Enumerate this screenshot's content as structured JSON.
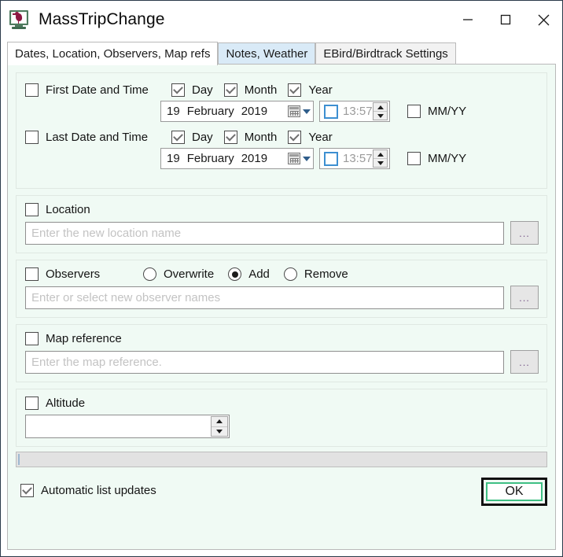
{
  "window": {
    "title": "MassTripChange",
    "icon": "app-bird-monitor-icon",
    "controls": {
      "minimize": "—",
      "maximize": "□",
      "close": "✕"
    }
  },
  "tabs": [
    {
      "label": "Dates, Location, Observers, Map refs",
      "state": "active"
    },
    {
      "label": "Notes, Weather",
      "state": "hot"
    },
    {
      "label": "EBird/Birdtrack Settings",
      "state": "normal"
    }
  ],
  "dates_group": {
    "first": {
      "label": "First Date and Time",
      "checked": false,
      "parts": [
        {
          "label": "Day",
          "checked": true
        },
        {
          "label": "Month",
          "checked": true
        },
        {
          "label": "Year",
          "checked": true
        }
      ],
      "date": {
        "day": "19",
        "month": "February",
        "year": "2019"
      },
      "time": {
        "value": "13:57",
        "checked": false
      },
      "mmyy": {
        "label": "MM/YY",
        "checked": false
      }
    },
    "last": {
      "label": "Last Date and Time",
      "checked": false,
      "parts": [
        {
          "label": "Day",
          "checked": true
        },
        {
          "label": "Month",
          "checked": true
        },
        {
          "label": "Year",
          "checked": true
        }
      ],
      "date": {
        "day": "19",
        "month": "February",
        "year": "2019"
      },
      "time": {
        "value": "13:57",
        "checked": false
      },
      "mmyy": {
        "label": "MM/YY",
        "checked": false
      }
    }
  },
  "location_group": {
    "label": "Location",
    "checked": false,
    "input": {
      "value": "",
      "placeholder": "Enter the new location name"
    },
    "browse_label": "..."
  },
  "observers_group": {
    "label": "Observers",
    "checked": false,
    "modes": [
      {
        "label": "Overwrite",
        "selected": false
      },
      {
        "label": "Add",
        "selected": true
      },
      {
        "label": "Remove",
        "selected": false
      }
    ],
    "input": {
      "value": "",
      "placeholder": "Enter or select new observer names"
    },
    "browse_label": "..."
  },
  "map_group": {
    "label": "Map reference",
    "checked": false,
    "input": {
      "value": "",
      "placeholder": "Enter the map reference."
    },
    "browse_label": "..."
  },
  "altitude_group": {
    "label": "Altitude",
    "checked": false,
    "input": {
      "value": "",
      "placeholder": ""
    }
  },
  "footer": {
    "progress_percent": 0,
    "auto_update": {
      "label": "Automatic list updates",
      "checked": true
    },
    "ok_label": "OK"
  },
  "colors": {
    "page_background": "#f0faf4",
    "accent_green": "#3fbf84",
    "tab_hot": "#d9eaf7",
    "focus_blue": "#3d8fd1",
    "placeholder": "#c3c3c3"
  }
}
